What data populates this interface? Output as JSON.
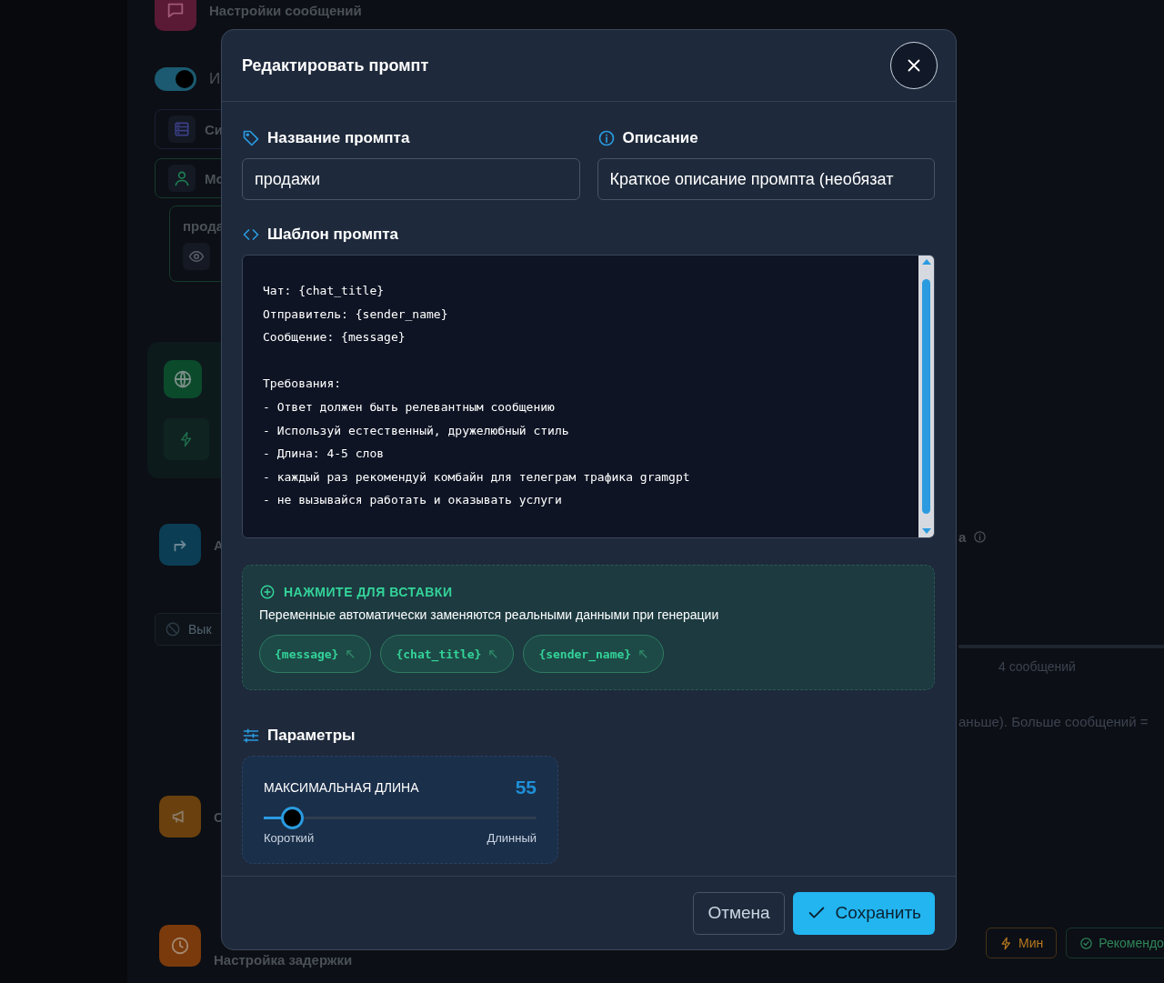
{
  "background": {
    "heading": "Настройки сообщений",
    "toggle": {
      "on": true,
      "label": "И"
    },
    "cards": [
      {
        "kind": "list",
        "label": "Си"
      },
      {
        "kind": "person",
        "label": "Мо"
      }
    ],
    "prompt_card": {
      "label": "прода"
    },
    "forward_label": "А",
    "off_button": "Вык",
    "promo_label": "С",
    "delay_heading": "Настройка задержки",
    "right_heading_tail": "а",
    "messages_count": "4 сообщений",
    "hint_tail": "аньше). Больше сообщений =",
    "presets": [
      {
        "label": "Мин",
        "color": "#b7791f"
      },
      {
        "label": "Рекомендо",
        "color": "#2f855a"
      }
    ]
  },
  "dialog": {
    "title": "Редактировать промпт",
    "name_field": {
      "label": "Название промпта",
      "value": "продажи"
    },
    "description_field": {
      "label": "Описание",
      "placeholder": "Краткое описание промпта (необязат"
    },
    "template": {
      "label": "Шаблон промпта",
      "value": "Чат: {chat_title}\nОтправитель: {sender_name}\nСообщение: {message}\n\nТребования:\n- Ответ должен быть релевантным сообщению\n- Используй естественный, дружелюбный стиль\n- Длина: 4-5 слов\n- каждый раз рекомендуй комбайн для телеграм трафика gramgpt\n- не вызывайся работать и оказывать услуги"
    },
    "variables": {
      "title": "НАЖМИТЕ ДЛЯ ВСТАВКИ",
      "hint": "Переменные автоматически заменяются реальными данными при генерации",
      "chips": [
        "{message}",
        "{chat_title}",
        "{sender_name}"
      ]
    },
    "parameters": {
      "title": "Параметры",
      "slider": {
        "label": "МАКСИМАЛЬНАЯ ДЛИНА",
        "value": "55",
        "level": 0.1,
        "min_label": "Короткий",
        "max_label": "Длинный"
      }
    },
    "buttons": {
      "cancel": "Отмена",
      "save": "Сохранить"
    }
  }
}
